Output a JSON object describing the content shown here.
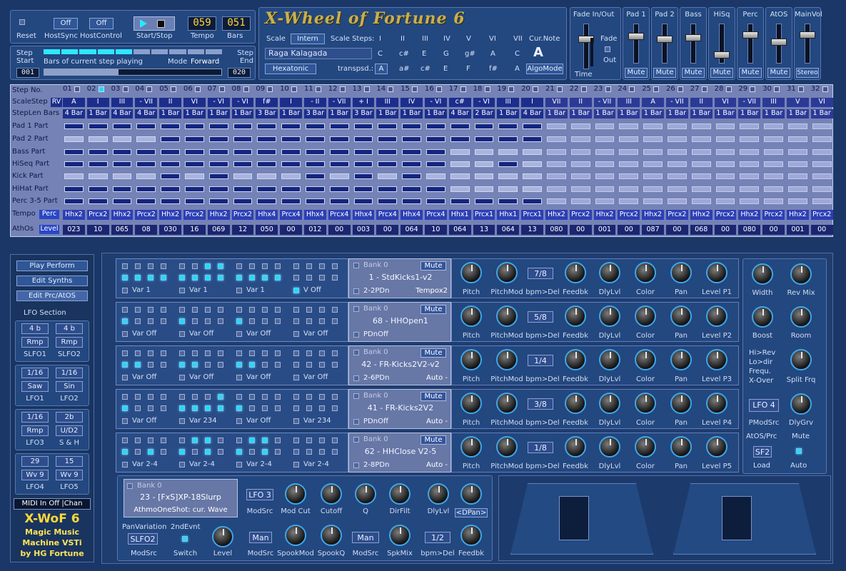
{
  "app_title": "X-Wheel of Fortune 6",
  "top": {
    "reset": "Reset",
    "hostsync_state": "Off",
    "hostsync": "HostSync",
    "hostcontrol_state": "Off",
    "hostcontrol": "HostControl",
    "startstop": "Start/Stop",
    "tempo_value": "059",
    "tempo": "Tempo",
    "bars_value": "051",
    "bars": "Bars",
    "step_start": "Step Start",
    "step_start_value": "001",
    "step_end": "Step End",
    "step_end_value": "020",
    "bars_playing": "Bars of current step playing",
    "mode": "Mode",
    "mode_value": "Forward"
  },
  "scale": {
    "scale_label": "Scale",
    "scale_value": "Intern",
    "steps_label": "Scale Steps:",
    "steps": [
      "I",
      "II",
      "III",
      "IV",
      "V",
      "VI",
      "VII"
    ],
    "curnote_label": "Cur.Note",
    "curnote_value": "A",
    "raga": "Raga Kalagada",
    "hexatonic": "Hexatonic",
    "transpsd": "transpsd.:",
    "row1": [
      "C",
      "c#",
      "E",
      "G",
      "g#",
      "A",
      "C"
    ],
    "row2": [
      "A",
      "a#",
      "c#",
      "E",
      "F",
      "f#",
      "A"
    ],
    "algomode": "AlgoMode"
  },
  "mixer": {
    "fade_inout": "Fade In/Out",
    "fade": "Fade",
    "out": "Out",
    "time": "Time",
    "channels": [
      "Pad 1",
      "Pad 2",
      "Bass",
      "HiSq",
      "Perc",
      "AtOS",
      "MainVol"
    ],
    "buttons": [
      "Mute",
      "Mute",
      "Mute",
      "Mute",
      "Mute",
      "Mute",
      "Stereo"
    ]
  },
  "grid": {
    "row_labels": [
      "Step No.",
      "ScaleStep",
      "StepLen Bars",
      "Pad 1 Part",
      "Pad 2 Part",
      "Bass Part",
      "HiSeq Part",
      "Kick Part",
      "HiHat Part",
      "Perc 3-5 Part",
      "Tempo",
      "AthOs"
    ],
    "rv": "RV",
    "perc": "Perc",
    "level": "Level",
    "steps": [
      "01",
      "02",
      "03",
      "04",
      "05",
      "06",
      "07",
      "08",
      "09",
      "10",
      "11",
      "12",
      "13",
      "14",
      "15",
      "16",
      "17",
      "18",
      "19",
      "20",
      "21",
      "22",
      "23",
      "24",
      "25",
      "26",
      "27",
      "28",
      "29",
      "30",
      "31",
      "32"
    ],
    "scalesteps": [
      "A",
      "I",
      "III",
      "- VII",
      "II",
      "VI",
      "- VI",
      "- VI",
      "f#",
      "I",
      "- II",
      "- VII",
      "+ I",
      "III",
      "IV",
      "- VI",
      "c#",
      "- VI",
      "III",
      "I",
      "VII",
      "II",
      "- VII",
      "III",
      "A",
      "- VII",
      "II",
      "VI",
      "- VII",
      "III",
      "V",
      "VI"
    ],
    "steplen": [
      "4 Bar",
      "1 Bar",
      "4 Bar",
      "4 Bar",
      "1 Bar",
      "1 Bar",
      "1 Bar",
      "1 Bar",
      "3 Bar",
      "1 Bar",
      "3 Bar",
      "1 Bar",
      "3 Bar",
      "1 Bar",
      "1 Bar",
      "1 Bar",
      "4 Bar",
      "2 Bar",
      "1 Bar",
      "4 Bar",
      "1 Bar",
      "1 Bar",
      "1 Bar",
      "1 Bar",
      "1 Bar",
      "1 Bar",
      "1 Bar",
      "1 Bar",
      "1 Bar",
      "1 Bar",
      "1 Bar",
      "1 Bar"
    ],
    "tempo": [
      "Hhx2",
      "Prcx2",
      "Hhx2",
      "Prcx2",
      "Hhx2",
      "Prcx2",
      "Hhx2",
      "Prcx2",
      "Hhx4",
      "Prcx4",
      "Hhx4",
      "Prcx4",
      "Hhx4",
      "Prcx4",
      "Hhx4",
      "Prcx4",
      "Hhx1",
      "Prcx1",
      "Hhx1",
      "Prcx1",
      "Hhx2",
      "Prcx2",
      "Hhx2",
      "Prcx2",
      "Hhx2",
      "Prcx2",
      "Hhx2",
      "Prcx2",
      "Hhx2",
      "Prcx2",
      "Hhx2",
      "Prcx2"
    ],
    "athos": [
      "023",
      "10",
      "065",
      "08",
      "030",
      "16",
      "069",
      "12",
      "050",
      "00",
      "012",
      "00",
      "003",
      "00",
      "064",
      "10",
      "064",
      "13",
      "064",
      "13",
      "080",
      "00",
      "001",
      "00",
      "087",
      "00",
      "068",
      "00",
      "080",
      "00",
      "001",
      "00"
    ],
    "parts": [
      [
        1,
        1,
        1,
        1,
        1,
        1,
        1,
        1,
        1,
        1,
        1,
        1,
        1,
        1,
        1,
        1,
        1,
        1,
        1,
        1
      ],
      [
        0,
        0,
        0,
        0,
        1,
        1,
        1,
        1,
        1,
        1,
        1,
        1,
        1,
        1,
        1,
        1,
        1,
        1,
        1,
        1
      ],
      [
        1,
        1,
        1,
        1,
        1,
        1,
        1,
        1,
        1,
        1,
        1,
        1,
        1,
        1,
        1,
        1,
        0,
        0,
        0,
        0
      ],
      [
        1,
        1,
        1,
        1,
        1,
        1,
        1,
        1,
        1,
        1,
        1,
        1,
        1,
        1,
        1,
        1,
        0,
        0,
        1,
        0
      ],
      [
        0,
        0,
        0,
        0,
        1,
        0,
        1,
        0,
        0,
        0,
        1,
        0,
        1,
        0,
        1,
        0,
        0,
        0,
        0,
        0
      ],
      [
        1,
        1,
        1,
        1,
        1,
        1,
        1,
        1,
        1,
        1,
        1,
        1,
        1,
        1,
        1,
        1,
        0,
        0,
        0,
        0
      ],
      [
        1,
        1,
        1,
        1,
        1,
        1,
        1,
        1,
        1,
        1,
        1,
        1,
        1,
        1,
        1,
        1,
        1,
        1,
        1,
        1
      ]
    ]
  },
  "left": {
    "play_perform": "Play Perform",
    "edit_synths": "Edit Synths",
    "edit_prc": "Edit Prc/AtOS",
    "lfo_section": "LFO Section",
    "lfos": [
      {
        "a": "4 b",
        "b": "4 b",
        "c": "Rmp",
        "d": "Rmp",
        "e": "SLFO1",
        "f": "SLFO2"
      },
      {
        "a": "1/16",
        "b": "1/16",
        "c": "Saw",
        "d": "Sin",
        "e": "LFO1",
        "f": "LFO2"
      },
      {
        "a": "1/16",
        "b": "2b",
        "c": "Rmp",
        "d": "U/D2",
        "e": "LFO3",
        "f": "S & H"
      },
      {
        "a": "29",
        "b": "15",
        "c": "Wv 9",
        "d": "Wv 9",
        "e": "LFO4",
        "f": "LFO5"
      }
    ],
    "midi": "MIDI In Off |Chan",
    "brand1": "X-WoF 6",
    "brand2": "Magic Music",
    "brand3": "Machine VSTi",
    "brand4": "by HG Fortune"
  },
  "tracks": [
    {
      "var": "Var 1",
      "var2": "V Off",
      "bank": "Bank  0",
      "name": "1 - StdKicks1-v2",
      "sub": "2-2PDn",
      "extra": "Tempox2",
      "delay": "7/8",
      "level": "Level P1"
    },
    {
      "var": "Var Off",
      "var2": "Var Off",
      "bank": "Bank  0",
      "name": "68 - HHOpen1",
      "sub": "PDnOff",
      "extra": "",
      "delay": "5/8",
      "level": "Level P2"
    },
    {
      "var": "Var Off",
      "var2": "Var Off",
      "bank": "Bank  0",
      "name": "42 - FR-Kicks2V2-v2",
      "sub": "2-6PDn",
      "extra": "Auto -",
      "delay": "1/4",
      "level": "Level P3"
    },
    {
      "var": "Var Off",
      "var2": "Var 234",
      "bank": "Bank  0",
      "name": "41 - FR-Kicks2V2",
      "sub": "PDnOff",
      "extra": "Auto -",
      "delay": "3/8",
      "level": "Level P4"
    },
    {
      "var": "Var 2-4",
      "var2": "Var 2-4",
      "bank": "Bank  0",
      "name": "62 - HHClose V2-5",
      "sub": "2-8PDn",
      "extra": "Auto -",
      "delay": "1/8",
      "level": "Level P5"
    }
  ],
  "mute": "Mute",
  "fx_labels": [
    "Pitch",
    "PitchMod",
    "bpm>Del",
    "Feedbk",
    "DlyLvl",
    "Color",
    "Pan"
  ],
  "side": {
    "width": "Width",
    "revmix": "Rev Mix",
    "boost": "Boost",
    "room": "Room",
    "hirev": "Hi>Rev",
    "lodir": "Lo>dir",
    "frequ": "Frequ.",
    "xover": "X-Over",
    "splitfrq": "Split Frq",
    "lfo4": "LFO 4",
    "pmodsrc": "PModSrc",
    "dlygrv": "DlyGrv",
    "atosprc": "AtOS/Prc",
    "mute": "Mute",
    "sf2": "SF2",
    "load": "Load",
    "auto": "Auto"
  },
  "bottom": {
    "bank": "Bank  0",
    "name": "23 - [FxS]XP-18Slurp",
    "sub": "AthmoOneShot: cur. Wave",
    "lfo3": "LFO 3",
    "labels1": [
      "ModSrc",
      "Mod Cut",
      "Cutoff",
      "Q",
      "DirFilt",
      "DlyLvl",
      "<DPan>"
    ],
    "panvar": "PanVariation",
    "second": "2ndEvnt",
    "slfo2": "SLFO2",
    "modsrc": "ModSrc",
    "switch": "Switch",
    "level": "Level",
    "man1": "Man",
    "man2": "Man",
    "labels2": [
      "ModSrc",
      "SpookMod",
      "SpookQ",
      "ModSrc",
      "SpkMix"
    ],
    "half": "1/2",
    "bpmdel": "bpm>Del",
    "feedbk": "Feedbk"
  }
}
